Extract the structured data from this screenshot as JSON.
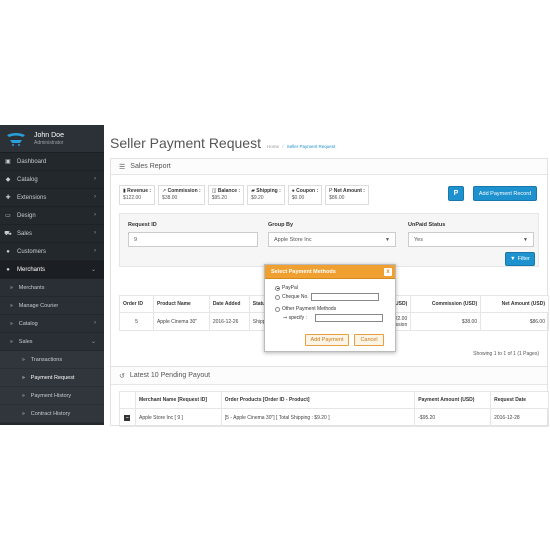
{
  "sidebar": {
    "user_name": "John Doe",
    "user_role": "Administrator",
    "items": [
      {
        "label": "Dashboard",
        "icon": "dashboard-icon",
        "has_chevron": false
      },
      {
        "label": "Catalog",
        "icon": "tag-icon",
        "has_chevron": true
      },
      {
        "label": "Extensions",
        "icon": "puzzle-icon",
        "has_chevron": true
      },
      {
        "label": "Design",
        "icon": "monitor-icon",
        "has_chevron": true
      },
      {
        "label": "Sales",
        "icon": "cart-icon",
        "has_chevron": true
      },
      {
        "label": "Customers",
        "icon": "users-icon",
        "has_chevron": true
      },
      {
        "label": "Merchants",
        "icon": "users-icon",
        "has_chevron": true
      }
    ],
    "merchant_sub": [
      {
        "label": "Merchants"
      },
      {
        "label": "Manage Courier"
      },
      {
        "label": "Catalog"
      },
      {
        "label": "Sales"
      }
    ],
    "sales_sub": [
      {
        "label": "Transactions"
      },
      {
        "label": "Payment Request"
      },
      {
        "label": "Payment History"
      },
      {
        "label": "Contract History"
      }
    ]
  },
  "header": {
    "title": "Seller Payment Request",
    "breadcrumb_home": "Home",
    "breadcrumb_sep": "/",
    "breadcrumb_current": "Seller Payment Request"
  },
  "sales_report": {
    "title": "Sales Report",
    "stats": [
      {
        "label": "Revenue :",
        "value": "$122.00",
        "icon": "money-icon"
      },
      {
        "label": "Commission :",
        "value": "$38.00",
        "icon": "chart-icon"
      },
      {
        "label": "Balance :",
        "value": "$95.20",
        "icon": "balance-icon"
      },
      {
        "label": "Shipping :",
        "value": "$9.20",
        "icon": "truck-icon"
      },
      {
        "label": "Coupon :",
        "value": "$0.00",
        "icon": "coupon-icon"
      },
      {
        "label": "Net Amount :",
        "value": "$86.00",
        "icon": "paypal-icon"
      }
    ],
    "paypal_button": "P",
    "add_record_button": "Add Payment Record"
  },
  "filter": {
    "request_id_label": "Request ID",
    "request_id_value": "9",
    "group_by_label": "Group By",
    "group_by_value": "Apple Store Inc",
    "unpaid_label": "UnPaid Status",
    "unpaid_value": "Yes",
    "filter_button": "Filter"
  },
  "orders_table": {
    "headers": [
      "Order ID",
      "Product Name",
      "Date Added",
      "Status",
      "Total (USD)",
      "Commission (USD)",
      "Net Amount (USD)"
    ],
    "header_visible": [
      "Order ID",
      "Product Name",
      "Date Added",
      "Statu",
      "al (USD)",
      "Commission (USD)",
      "Net Amount (USD)"
    ],
    "rows": [
      {
        "order_id": "5",
        "product": "Apple Cinema 30\"",
        "date": "2016-12-26",
        "status": "Shipp",
        "total": "$122.00",
        "total2": "mission",
        "commission": "$38.00",
        "net": "$86.00"
      }
    ],
    "showing": "Showing 1 to 1 of 1 (1 Pages)"
  },
  "payout": {
    "title": "Latest 10 Pending Payout",
    "headers": [
      "Merchant Name [Request ID]",
      "Order Products [Order ID - Product]",
      "Payment Amount (USD)",
      "Request Date"
    ],
    "rows": [
      {
        "merchant": "Apple Store Inc [ 9 ]",
        "products": "[5 - Apple Cinema 30\"] [ Total Shipping : $9.20 ]",
        "amount": "-$95.20",
        "date": "2016-12-28"
      }
    ]
  },
  "modal": {
    "title": "Select Payment Methods",
    "close": "x",
    "opt_paypal": "PayPal",
    "opt_cheque": "Cheque No.",
    "opt_other": "Other Payment Methods",
    "specify_label": "⇒ specify :",
    "add_button": "Add Payment",
    "cancel_button": "Cancel"
  },
  "colors": {
    "sidebar_bg": "#23282d",
    "primary": "#1e91cf",
    "modal_header": "#f0a030"
  }
}
